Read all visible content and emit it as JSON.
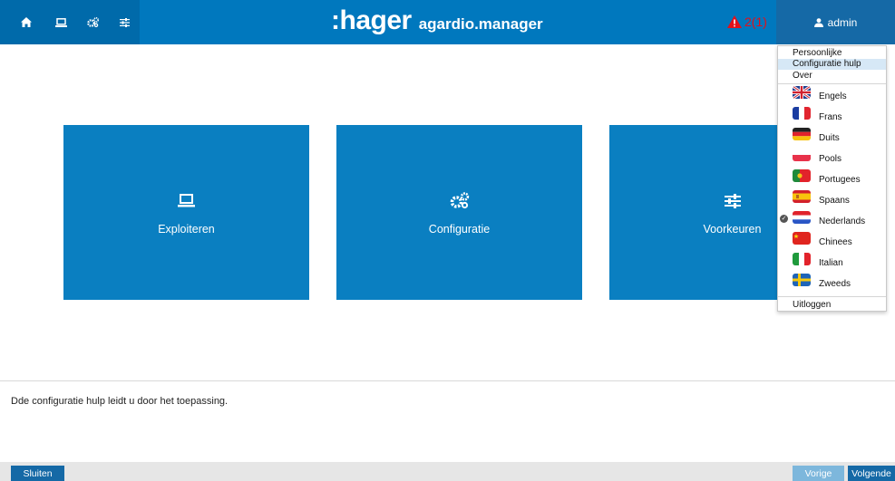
{
  "header": {
    "logo_main": ":hager",
    "logo_sub": "agardio.manager",
    "alert_count": "2(1)",
    "user": "admin",
    "nav_icons": [
      "home-icon",
      "laptop-icon",
      "gears-icon",
      "sliders-icon"
    ]
  },
  "tiles": [
    {
      "label": "Exploiteren",
      "icon": "laptop-icon"
    },
    {
      "label": "Configuratie",
      "icon": "gears-icon"
    },
    {
      "label": "Voorkeuren",
      "icon": "sliders-icon"
    }
  ],
  "dropdown": {
    "items": [
      "Persoonlijke instellingen",
      "Configuratie hulp",
      "Over"
    ],
    "highlighted": "Configuratie hulp",
    "languages": [
      "Engels",
      "Frans",
      "Duits",
      "Pools",
      "Portugees",
      "Spaans",
      "Nederlands",
      "Chinees",
      "Italian",
      "Zweeds"
    ],
    "selected_language": "Nederlands",
    "logout": "Uitloggen"
  },
  "help_text": "Dde configuratie hulp leidt u door het toepassing.",
  "footer": {
    "close": "Sluiten",
    "previous": "Vorige",
    "next": "Volgende"
  },
  "colors": {
    "topbar": "#0078be",
    "tile": "#0a7fc1",
    "alert": "#e3101a",
    "button_primary": "#1569a6",
    "button_disabled": "#7db7dc"
  }
}
